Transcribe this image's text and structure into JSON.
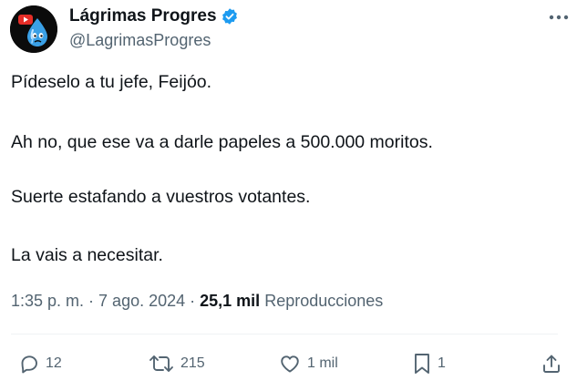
{
  "author": {
    "display_name": "Lágrimas Progres",
    "handle": "@LagrimasProgres",
    "verified": true,
    "avatar_icon": "crying-drop-mascot",
    "verified_badge_color": "#1d9bf0"
  },
  "more_icon": "more-horizontal-icon",
  "tweet": {
    "lines": [
      "Pídeselo a tu jefe, Feijóo.",
      "Ah no, que ese va a darle papeles a 500.000 moritos.",
      "Suerte estafando a vuestros votantes.",
      "La vais a necesitar."
    ]
  },
  "meta": {
    "time": "1:35 p. m.",
    "separator": " · ",
    "date": "7 ago. 2024",
    "views_count": "25,1 mil",
    "views_label": "Reproducciones"
  },
  "actions": {
    "reply": {
      "icon": "reply-icon",
      "count": "12"
    },
    "retweet": {
      "icon": "retweet-icon",
      "count": "215"
    },
    "like": {
      "icon": "heart-icon",
      "count": "1 mil"
    },
    "bookmark": {
      "icon": "bookmark-icon",
      "count": "1"
    },
    "share": {
      "icon": "share-icon"
    }
  },
  "colors": {
    "text_primary": "#0f1419",
    "text_secondary": "#536471",
    "accent": "#1d9bf0",
    "divider": "#eff3f4"
  }
}
